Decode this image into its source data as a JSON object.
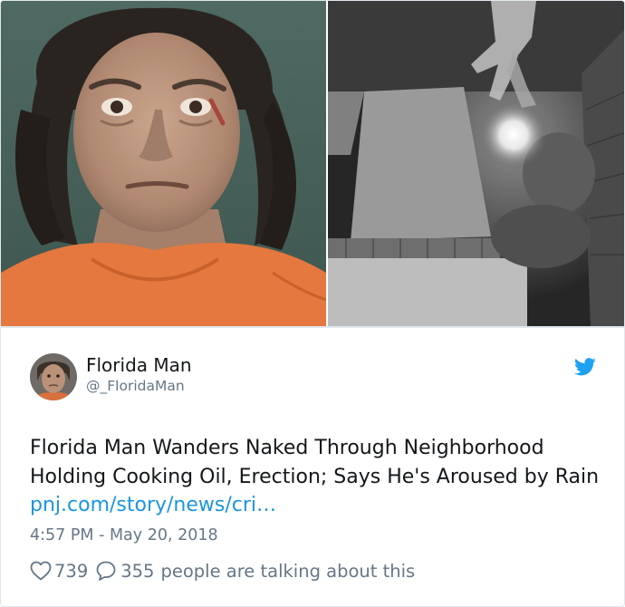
{
  "author": {
    "name": "Florida Man",
    "handle": "@_FloridaMan",
    "avatar_icon": "florida-man-avatar"
  },
  "tweet": {
    "text": "Florida Man Wanders Naked Through Neighborhood Holding Cooking Oil, Erection; Says He's Aroused by Rain",
    "link_text": "pnj.com/story/news/cri…",
    "timestamp": "4:57 PM - May 20, 2018"
  },
  "actions": {
    "like_icon": "heart-icon",
    "like_count": "739",
    "reply_icon": "speech-bubble-icon",
    "reply_count": "355",
    "talking_text": "people are talking about this"
  },
  "media": {
    "left_photo": "mugshot-photo",
    "right_photo": "security-camera-photo"
  },
  "colors": {
    "twitter_blue": "#1da1f2",
    "link_blue": "#1b95e0",
    "muted_text": "#657786",
    "primary_text": "#14171a",
    "border": "#e1e8ed"
  }
}
